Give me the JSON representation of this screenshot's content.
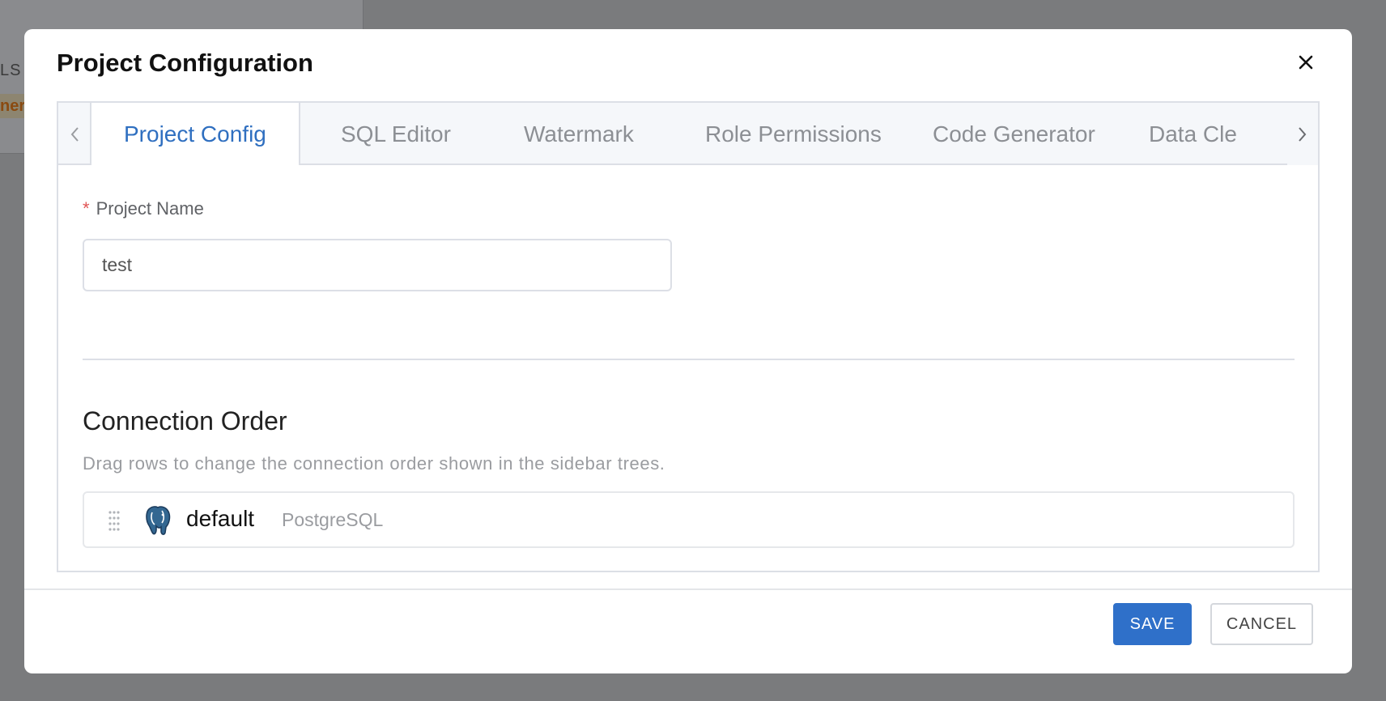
{
  "background": {
    "partial_label": "LS",
    "partial_badge": "ner"
  },
  "dialog": {
    "title": "Project Configuration",
    "close_icon": "close-icon"
  },
  "tabs": [
    {
      "label": "Project Config",
      "active": true
    },
    {
      "label": "SQL Editor",
      "active": false
    },
    {
      "label": "Watermark",
      "active": false
    },
    {
      "label": "Role Permissions",
      "active": false
    },
    {
      "label": "Code Generator",
      "active": false
    },
    {
      "label": "Data Cle",
      "active": false
    }
  ],
  "form": {
    "required_mark": "*",
    "project_name_label": "Project Name",
    "project_name_value": "test"
  },
  "connection_order": {
    "title": "Connection Order",
    "description": "Drag rows to change the connection order shown in the sidebar trees.",
    "rows": [
      {
        "name": "default",
        "type": "PostgreSQL",
        "icon": "postgresql-icon"
      }
    ]
  },
  "footer": {
    "save_label": "SAVE",
    "cancel_label": "CANCEL"
  },
  "colors": {
    "accent": "#2f70c9",
    "active_tab": "#2f6fc0",
    "required": "#e05555"
  }
}
